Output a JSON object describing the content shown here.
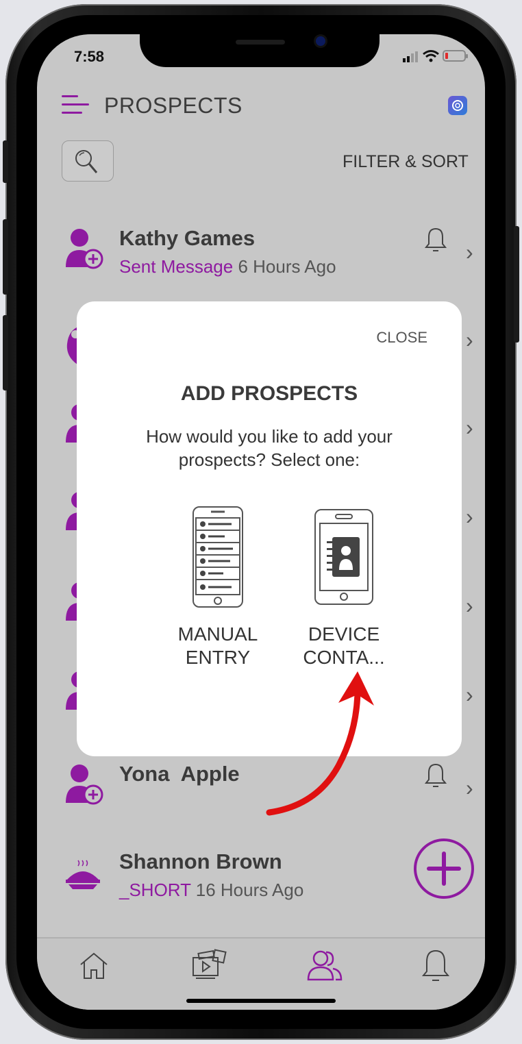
{
  "status_bar": {
    "time": "7:58"
  },
  "header": {
    "title": "PROSPECTS",
    "filter_label": "FILTER & SORT"
  },
  "prospects": [
    {
      "name": "Kathy Games",
      "status": "Sent Message",
      "time": "6 Hours Ago"
    },
    {
      "name": "Yona  Apple",
      "status": "",
      "time": ""
    },
    {
      "name": "Shannon Brown",
      "status": "_SHORT",
      "time": "16 Hours Ago"
    }
  ],
  "modal": {
    "close_label": "CLOSE",
    "title": "ADD PROSPECTS",
    "description": "How would you like to add your prospects? Select one:",
    "options": [
      {
        "label": "MANUAL ENTRY",
        "icon": "list-phone-icon"
      },
      {
        "label": "DEVICE CONTA...",
        "icon": "contacts-phone-icon"
      }
    ]
  },
  "tabs": [
    {
      "icon": "home-icon"
    },
    {
      "icon": "media-icon"
    },
    {
      "icon": "prospects-icon",
      "active": true
    },
    {
      "icon": "bell-icon"
    }
  ],
  "colors": {
    "accent": "#8e1aa0",
    "screen_bg": "#c7c7c7",
    "modal_bg": "#ffffff",
    "annotation_arrow": "#e01010"
  }
}
